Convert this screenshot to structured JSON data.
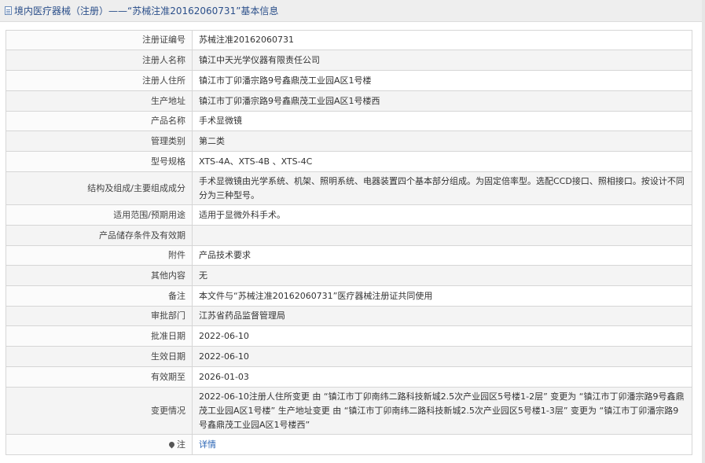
{
  "header": {
    "title": "境内医疗器械（注册）——“苏械注准20162060731”基本信息"
  },
  "rows": [
    {
      "label": "注册证编号",
      "value": "苏械注准20162060731"
    },
    {
      "label": "注册人名称",
      "value": "镇江中天光学仪器有限责任公司"
    },
    {
      "label": "注册人住所",
      "value": "镇江市丁卯潘宗路9号鑫鼎茂工业园A区1号楼"
    },
    {
      "label": "生产地址",
      "value": "镇江市丁卯潘宗路9号鑫鼎茂工业园A区1号楼西"
    },
    {
      "label": "产品名称",
      "value": "手术显微镜"
    },
    {
      "label": "管理类别",
      "value": "第二类"
    },
    {
      "label": "型号规格",
      "value": "XTS-4A、XTS-4B 、XTS-4C"
    },
    {
      "label": "结构及组成/主要组成成分",
      "value": "手术显微镜由光学系统、机架、照明系统、电器装置四个基本部分组成。为固定倍率型。选配CCD接口、照相接口。按设计不同分为三种型号。"
    },
    {
      "label": "适用范围/预期用途",
      "value": "适用于显微外科手术。"
    },
    {
      "label": "产品储存条件及有效期",
      "value": ""
    },
    {
      "label": "附件",
      "value": "产品技术要求"
    },
    {
      "label": "其他内容",
      "value": "无"
    },
    {
      "label": "备注",
      "value": "本文件与“苏械注准20162060731”医疗器械注册证共同使用"
    },
    {
      "label": "审批部门",
      "value": "江苏省药品监督管理局"
    },
    {
      "label": "批准日期",
      "value": "2022-06-10"
    },
    {
      "label": "生效日期",
      "value": "2022-06-10"
    },
    {
      "label": "有效期至",
      "value": "2026-01-03"
    },
    {
      "label": "变更情况",
      "value": "2022-06-10注册人住所变更 由 “镇江市丁卯南纬二路科技新城2.5次产业园区5号楼1-2层” 变更为 “镇江市丁卯潘宗路9号鑫鼎茂工业园A区1号楼” 生产地址变更 由 “镇江市丁卯南纬二路科技新城2.5次产业园区5号楼1-3层” 变更为 “镇江市丁卯潘宗路9号鑫鼎茂工业园A区1号楼西”"
    }
  ],
  "note_row": {
    "label": "注",
    "link_text": "详情"
  }
}
